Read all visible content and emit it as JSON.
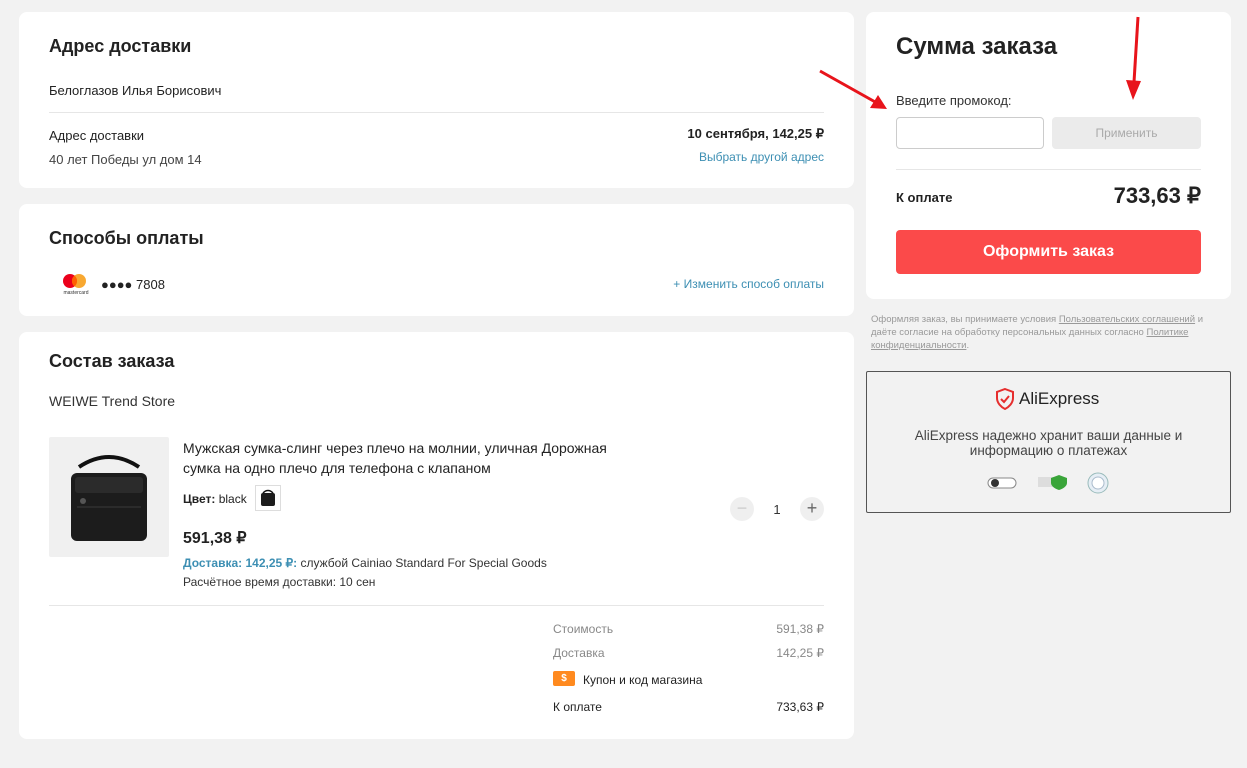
{
  "address": {
    "title": "Адрес доставки",
    "recipient": "Белоглазов Илья Борисович",
    "label": "Адрес доставки",
    "value": "40 лет Победы ул дом 14",
    "delivery_info": "10 сентября, 142,25 ₽",
    "change_link": "Выбрать другой адрес"
  },
  "payment": {
    "title": "Способы оплаты",
    "card_brand_text": "mastercard",
    "card_number": "●●●● 7808",
    "change_link": "+ Изменить способ оплаты"
  },
  "order": {
    "title": "Состав заказа",
    "store": "WEIWE Trend Store",
    "item": {
      "name_line1": "Мужская сумка-слинг через плечо на молнии, уличная Дорожная",
      "name_line2": "сумка на одно плечо для телефона с клапаном",
      "color_label": "Цвет:",
      "color_value": "black",
      "price": "591,38 ₽",
      "shipping_label": "Доставка: 142,25 ₽:",
      "shipping_service": "службой Cainiao Standard For Special Goods",
      "delivery_time": "Расчётное время доставки: 10 сен",
      "quantity": "1",
      "minus": "−",
      "plus": "+"
    },
    "totals": {
      "cost_label": "Стоимость",
      "cost_value": "591,38 ₽",
      "delivery_label": "Доставка",
      "delivery_value": "142,25 ₽",
      "coupon_icon": "$",
      "coupon_label": "Купон и код магазина",
      "total_label": "К оплате",
      "total_value": "733,63 ₽"
    }
  },
  "summary": {
    "title": "Сумма заказа",
    "promo_label": "Введите промокод:",
    "promo_placeholder": "",
    "apply_button": "Применить",
    "total_label": "К оплате",
    "total_value": "733,63 ₽",
    "order_button": "Оформить заказ"
  },
  "terms": {
    "prefix": "Оформляя заказ, вы принимаете условия ",
    "link1": "Пользовательских соглашений",
    "middle": " и даёте согласие на обработку персональных данных согласно ",
    "link2": "Политике конфиденциальности",
    "suffix": "."
  },
  "trust": {
    "brand": "AliExpress",
    "text_line1": "AliExpress надежно хранит ваши данные и",
    "text_line2": "информацию о платежах"
  },
  "colors": {
    "accent_red": "#fb4a4a",
    "link_blue": "#3d8fb3",
    "annotation_arrow": "#e8141b",
    "coupon_orange": "#ff8a1f"
  }
}
